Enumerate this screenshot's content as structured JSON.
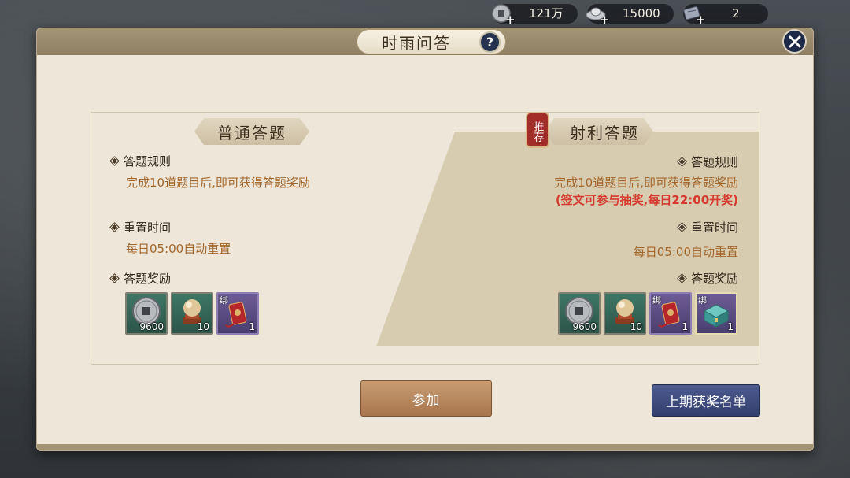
{
  "currency": [
    {
      "icon": "copper-coin-icon",
      "value": "121万"
    },
    {
      "icon": "silver-ingot-icon",
      "value": "15000"
    },
    {
      "icon": "ticket-icon",
      "value": "2"
    }
  ],
  "panel": {
    "title": "时雨问答",
    "help": "?"
  },
  "normal": {
    "title": "普通答题",
    "rules_label": "答题规则",
    "rules_text": "完成10道题目后,即可获得答题奖励",
    "reset_label": "重置时间",
    "reset_text": "每日05:00自动重置",
    "rewards_label": "答题奖励",
    "rewards": [
      {
        "icon": "copper-coin-icon",
        "qty": "9600",
        "bind": ""
      },
      {
        "icon": "pearl-icon",
        "qty": "10",
        "bind": ""
      },
      {
        "icon": "red-pouch-icon",
        "qty": "1",
        "bind": "绑"
      }
    ]
  },
  "shooting": {
    "badge": "推荐",
    "title": "射利答题",
    "rules_label": "答题规则",
    "rules_text": "完成10道题目后,即可获得答题奖励",
    "lottery_text": "(签文可参与抽奖,每日22:00开奖)",
    "reset_label": "重置时间",
    "reset_text": "每日05:00自动重置",
    "rewards_label": "答题奖励",
    "rewards": [
      {
        "icon": "copper-coin-icon",
        "qty": "9600",
        "bind": ""
      },
      {
        "icon": "pearl-icon",
        "qty": "10",
        "bind": ""
      },
      {
        "icon": "red-pouch-icon",
        "qty": "1",
        "bind": "绑"
      },
      {
        "icon": "jade-chest-icon",
        "qty": "1",
        "bind": "绑"
      }
    ]
  },
  "buttons": {
    "join": "参加",
    "winners": "上期获奖名单"
  },
  "colors": {
    "accent_brown": "#a4672b",
    "highlight_red": "#d63a2f",
    "join_button": "#b8875f",
    "winners_button": "#3f4b7e"
  }
}
